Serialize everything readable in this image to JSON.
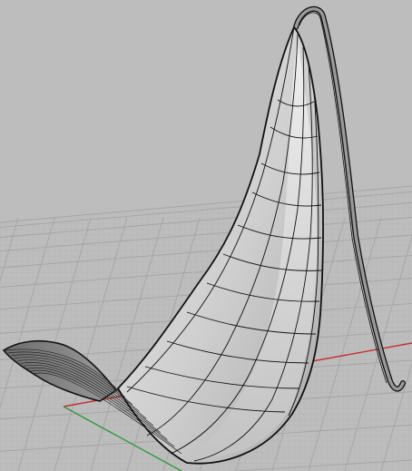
{
  "viewport": {
    "kind": "perspective",
    "display_mode": "shaded",
    "background_color": "#bdbdbd",
    "grid": {
      "visible": true,
      "minor_color": "#b2b2b2",
      "major_color": "#a4a4a4"
    },
    "axes": {
      "x_axis_color": "#c62e2e",
      "y_axis_color": "#2e9a3e"
    }
  },
  "model": {
    "object": "surface",
    "render_color": "#d9d9d9",
    "wire_color": "#111111",
    "strap": "curved-strip"
  }
}
